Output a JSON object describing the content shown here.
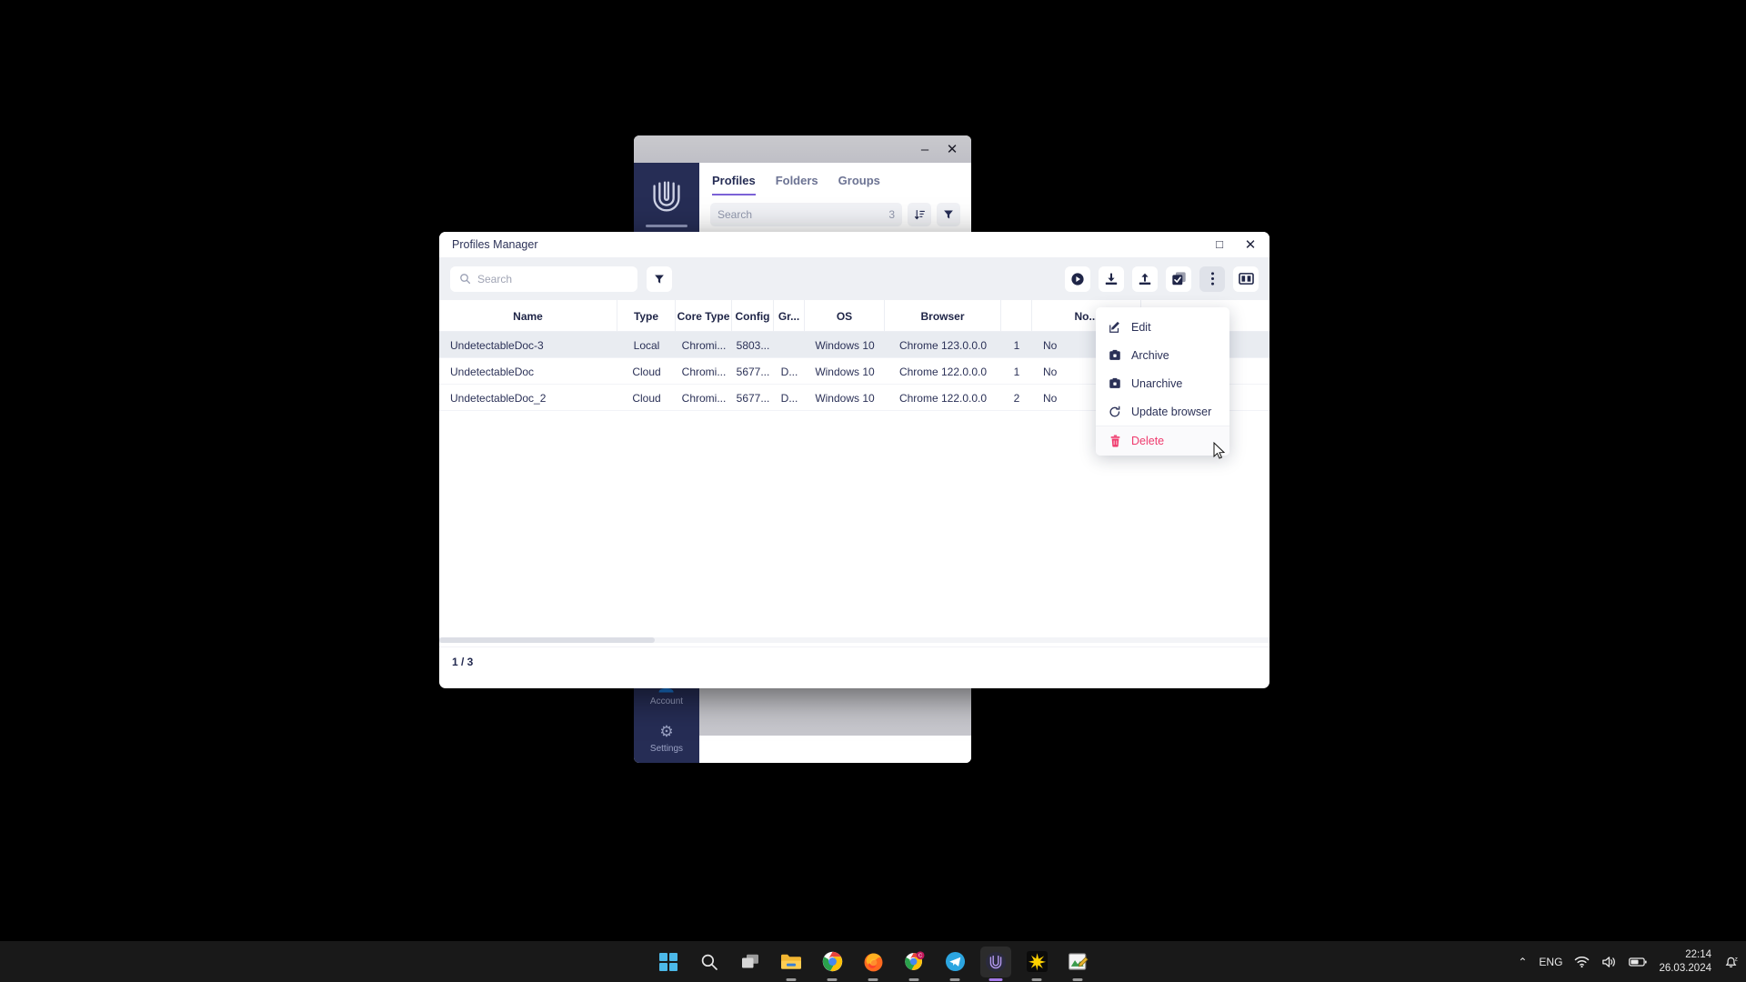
{
  "background_window": {
    "app_name": "Undetectable",
    "controls": {
      "minimize": "–",
      "close": "✕"
    },
    "tabs": [
      {
        "label": "Profiles",
        "active": true
      },
      {
        "label": "Folders",
        "active": false
      },
      {
        "label": "Groups",
        "active": false
      }
    ],
    "search": {
      "placeholder": "Search",
      "count": "3"
    },
    "sidebar": [
      {
        "label": "Account",
        "icon": "user-icon"
      },
      {
        "label": "Settings",
        "icon": "gear-icon"
      }
    ]
  },
  "profiles_manager": {
    "title": "Profiles Manager",
    "controls": {
      "maximize": "□",
      "close": "✕"
    },
    "search": {
      "placeholder": "Search",
      "value": ""
    },
    "toolbar": {
      "filter_label": "Filter",
      "buttons": [
        {
          "name": "start-profile-button",
          "icon": "play-icon"
        },
        {
          "name": "import-button",
          "icon": "download-icon"
        },
        {
          "name": "export-button",
          "icon": "upload-icon"
        },
        {
          "name": "select-all-button",
          "icon": "checkbox-icon"
        },
        {
          "name": "more-actions-button",
          "icon": "three-dots-icon",
          "active": true
        },
        {
          "name": "columns-button",
          "icon": "columns-icon"
        }
      ]
    },
    "table": {
      "columns": [
        "Name",
        "Type",
        "Core Type",
        "Config",
        "Gr...",
        "OS",
        "Browser",
        "",
        "No..."
      ],
      "rows": [
        {
          "name": "UndetectableDoc-3",
          "type": "Local",
          "core_type": "Chromi...",
          "config": "5803...",
          "group": "",
          "os": "Windows 10",
          "browser": "Chrome 123.0.0.0",
          "num": "1",
          "last": "No",
          "selected": true
        },
        {
          "name": "UndetectableDoc",
          "type": "Cloud",
          "core_type": "Chromi...",
          "config": "5677...",
          "group": "D...",
          "os": "Windows 10",
          "browser": "Chrome 122.0.0.0",
          "num": "1",
          "last": "No",
          "selected": false
        },
        {
          "name": "UndetectableDoc_2",
          "type": "Cloud",
          "core_type": "Chromi...",
          "config": "5677...",
          "group": "D...",
          "os": "Windows 10",
          "browser": "Chrome 122.0.0.0",
          "num": "2",
          "last": "No",
          "selected": false
        }
      ]
    },
    "status": {
      "pagination": "1 / 3"
    }
  },
  "context_menu": {
    "items": [
      {
        "label": "Edit",
        "icon": "edit-pencil-icon",
        "danger": false
      },
      {
        "label": "Archive",
        "icon": "archive-box-icon",
        "danger": false
      },
      {
        "label": "Unarchive",
        "icon": "unarchive-box-icon",
        "danger": false
      },
      {
        "label": "Update browser",
        "icon": "refresh-icon",
        "danger": false
      },
      {
        "label": "Delete",
        "icon": "trash-icon",
        "danger": true
      }
    ]
  },
  "taskbar": {
    "apps": [
      {
        "name": "start-button",
        "icon": "windows-logo-icon"
      },
      {
        "name": "search-taskbar-button",
        "icon": "search-icon"
      },
      {
        "name": "task-view-button",
        "icon": "task-view-icon"
      },
      {
        "name": "file-explorer-button",
        "icon": "folder-icon"
      },
      {
        "name": "chrome-button",
        "icon": "chrome-icon"
      },
      {
        "name": "firefox-button",
        "icon": "firefox-icon"
      },
      {
        "name": "chrome-canary-button",
        "icon": "chrome-badge-icon"
      },
      {
        "name": "telegram-button",
        "icon": "telegram-icon"
      },
      {
        "name": "undetectable-button",
        "icon": "undetectable-icon"
      },
      {
        "name": "app-star-button",
        "icon": "star-burst-icon"
      },
      {
        "name": "snipping-tool-button",
        "icon": "snipping-tool-icon"
      }
    ],
    "tray": {
      "overflow": "⌃",
      "language": "ENG",
      "wifi": "wifi-icon",
      "volume": "volume-icon",
      "battery": "battery-icon",
      "time": "22:14",
      "date": "26.03.2024",
      "notifications": "bell-icon"
    }
  },
  "colors": {
    "accent_dark": "#262d55",
    "accent_purple": "#7b61d6",
    "danger": "#ef3a6d",
    "toolbar_bg": "#eef0f4",
    "row_selected": "#e9ecf1"
  }
}
